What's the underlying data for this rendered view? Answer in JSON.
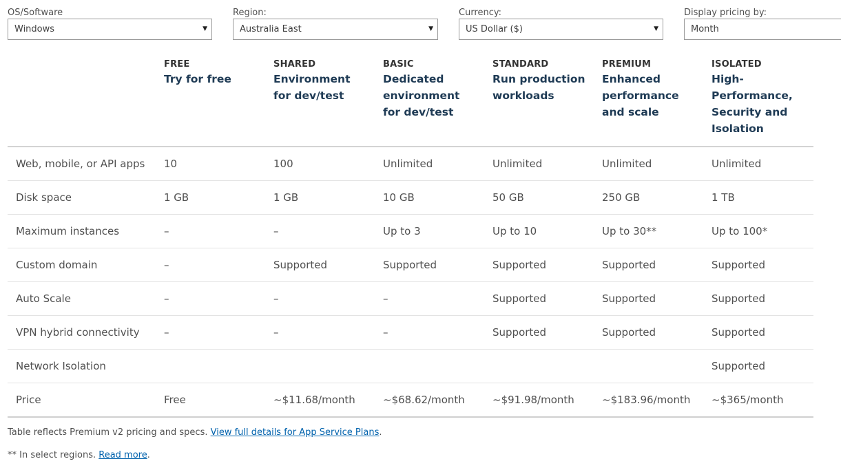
{
  "filters": {
    "os": {
      "label": "OS/Software",
      "value": "Windows"
    },
    "region": {
      "label": "Region:",
      "value": "Australia East"
    },
    "currency": {
      "label": "Currency:",
      "value": "US Dollar ($)"
    },
    "display": {
      "label": "Display pricing by:",
      "value": "Month"
    }
  },
  "tiers": [
    {
      "name": "FREE",
      "desc": "Try for free"
    },
    {
      "name": "SHARED",
      "desc": "Environment for dev/test"
    },
    {
      "name": "BASIC",
      "desc": "Dedicated environment for dev/test"
    },
    {
      "name": "STANDARD",
      "desc": "Run production workloads"
    },
    {
      "name": "PREMIUM",
      "desc": "Enhanced performance and scale"
    },
    {
      "name": "ISOLATED",
      "desc": "High-Performance, Security and Isolation"
    }
  ],
  "rows": [
    {
      "label": "Web, mobile, or API apps",
      "values": [
        "10",
        "100",
        "Unlimited",
        "Unlimited",
        "Unlimited",
        "Unlimited"
      ]
    },
    {
      "label": "Disk space",
      "values": [
        "1 GB",
        "1 GB",
        "10 GB",
        "50 GB",
        "250 GB",
        "1 TB"
      ]
    },
    {
      "label": "Maximum instances",
      "values": [
        "–",
        "–",
        "Up to 3",
        "Up to 10",
        "Up to 30**",
        "Up to 100*"
      ]
    },
    {
      "label": "Custom domain",
      "values": [
        "–",
        "Supported",
        "Supported",
        "Supported",
        "Supported",
        "Supported"
      ]
    },
    {
      "label": "Auto Scale",
      "values": [
        "–",
        "–",
        "–",
        "Supported",
        "Supported",
        "Supported"
      ]
    },
    {
      "label": "VPN hybrid connectivity",
      "values": [
        "–",
        "–",
        "–",
        "Supported",
        "Supported",
        "Supported"
      ]
    },
    {
      "label": "Network Isolation",
      "values": [
        "",
        "",
        "",
        "",
        "",
        "Supported"
      ]
    },
    {
      "label": "Price",
      "values": [
        "Free",
        "~$11.68/month",
        "~$68.62/month",
        "~$91.98/month",
        "~$183.96/month",
        "~$365/month"
      ]
    }
  ],
  "footer": {
    "note1_text": "Table reflects Premium v2 pricing and specs. ",
    "note1_link": "View full details for App Service Plans",
    "note1_end": ".",
    "note2_text": "** In select regions. ",
    "note2_link": "Read more",
    "note2_end": "."
  }
}
